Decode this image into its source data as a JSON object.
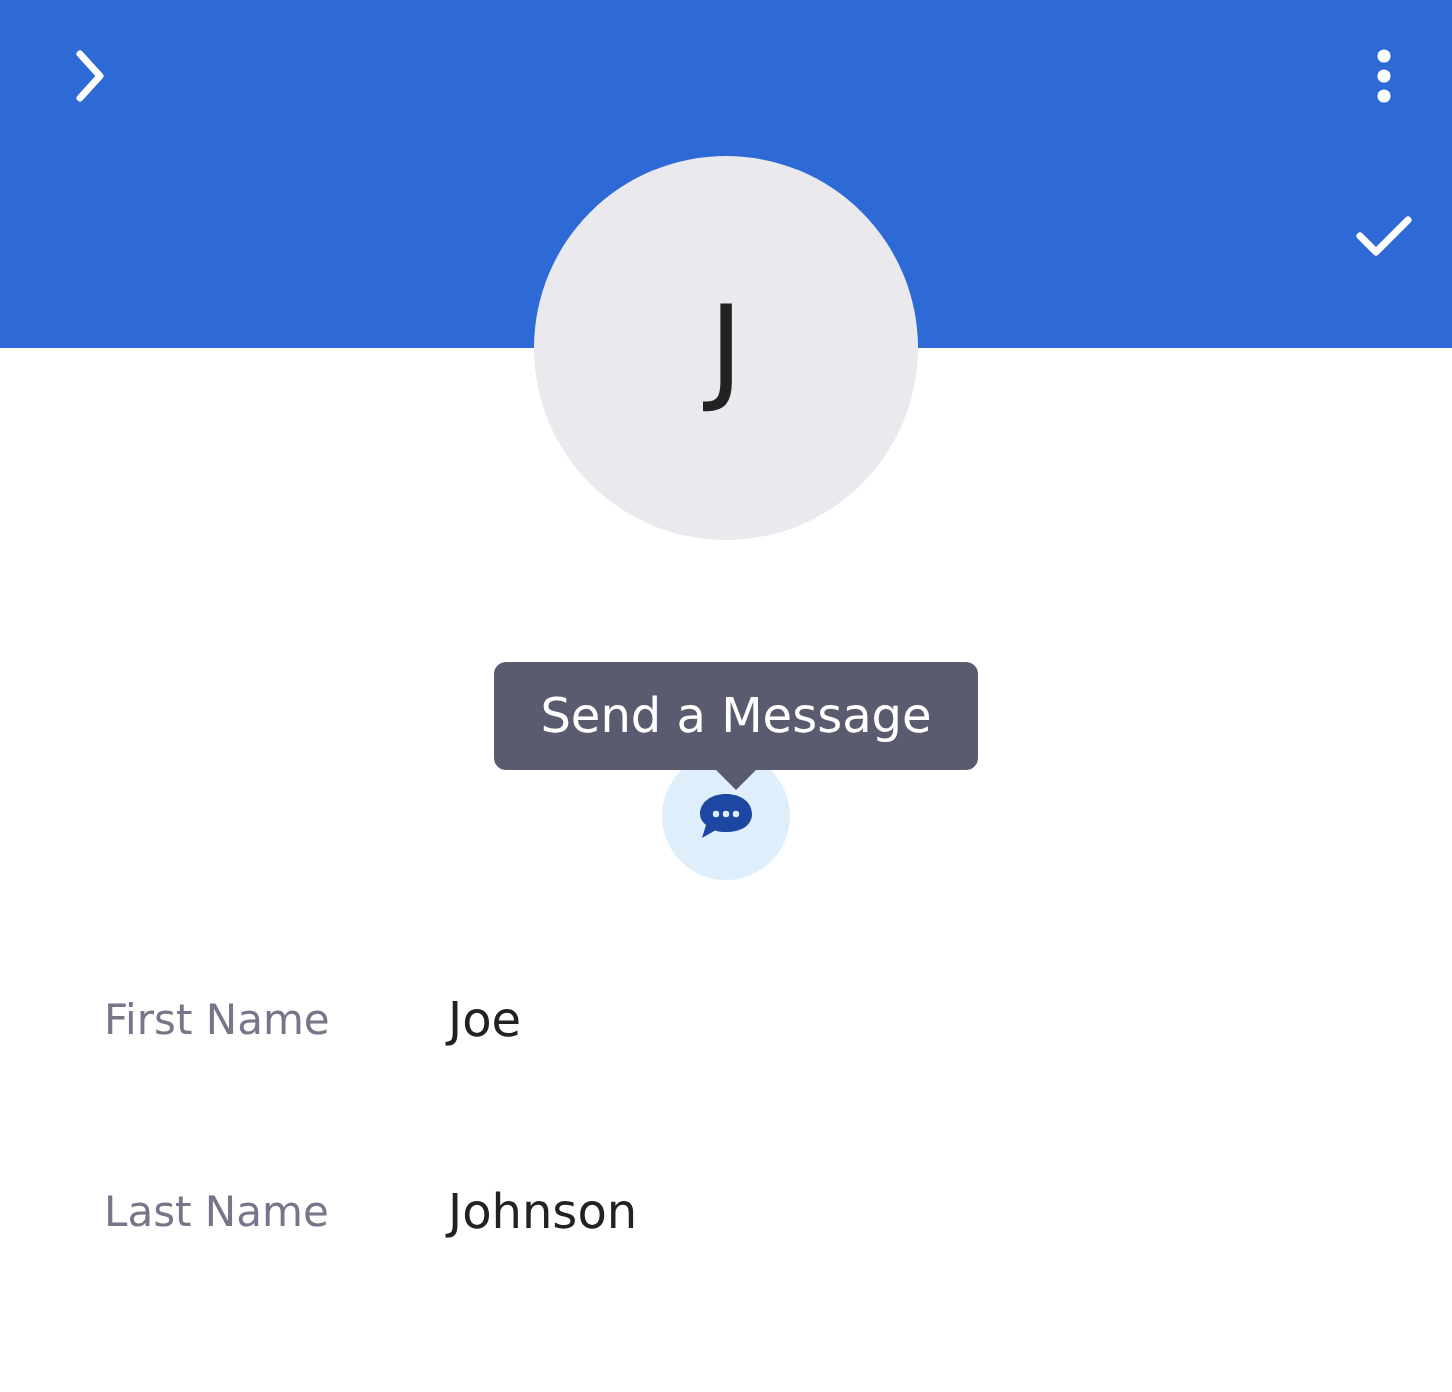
{
  "header": {
    "buttons": [
      {
        "kind": "back"
      },
      {
        "kind": "menu"
      },
      {
        "kind": "save"
      }
    ]
  },
  "avatar": {
    "initial": "J"
  },
  "tooltip": "Send a Message",
  "fields": [
    {
      "label": "First Name",
      "value": "Joe"
    },
    {
      "label": "Last Name",
      "value": "Johnson"
    }
  ]
}
